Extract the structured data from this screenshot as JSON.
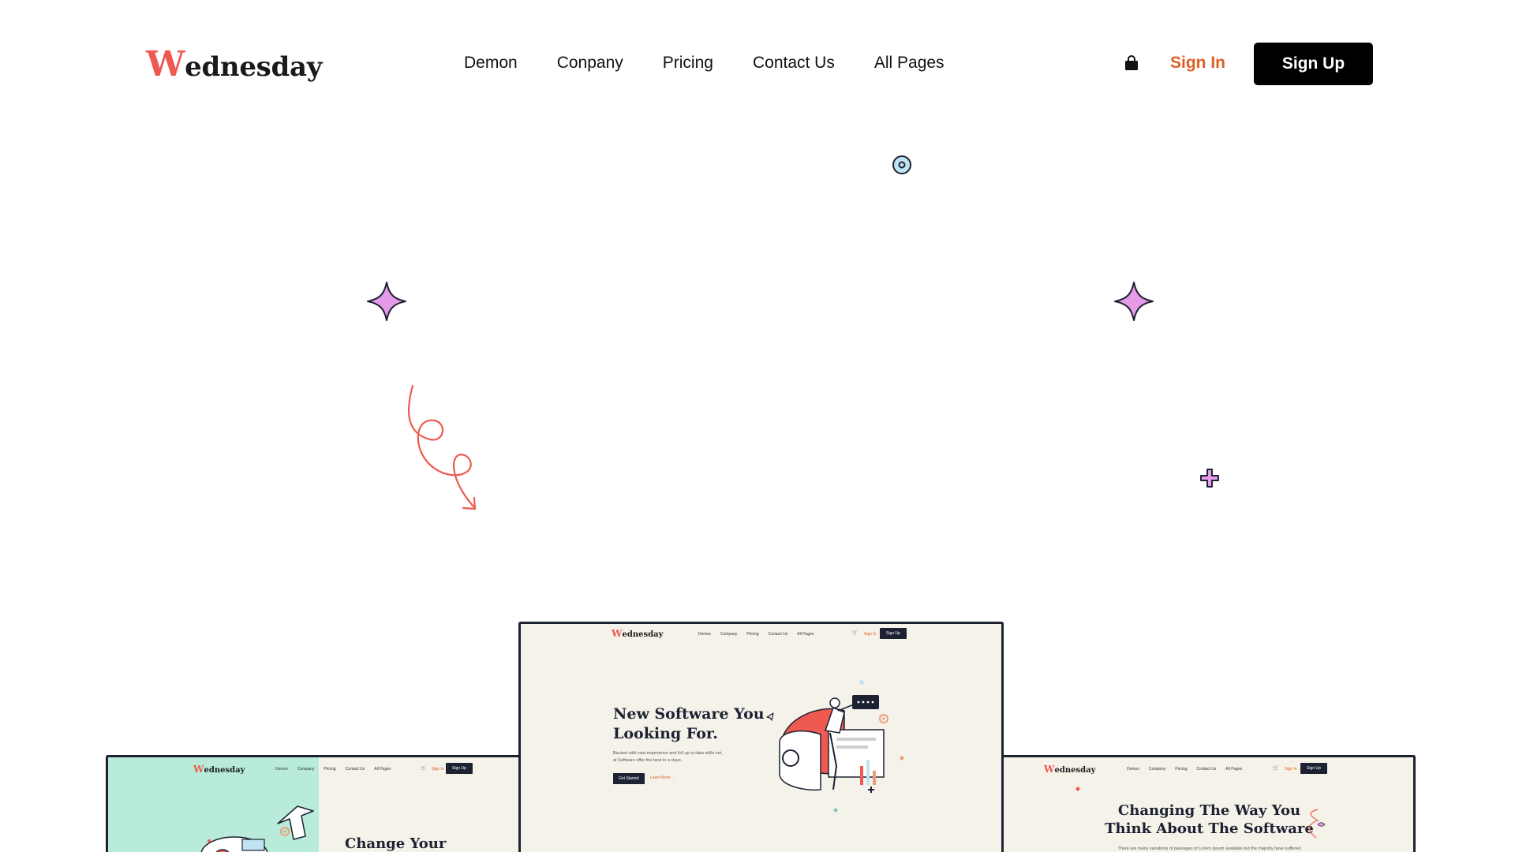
{
  "header": {
    "logo_initial": "W",
    "logo_rest": "ednesday",
    "nav": [
      "Demon",
      "Conpany",
      "Pricing",
      "Contact Us",
      "All Pages"
    ],
    "cart_icon": "shopping-bag-icon",
    "signin_label": "Sign In",
    "signup_label": "Sign Up"
  },
  "colors": {
    "accent": "#ee5a52",
    "signin": "#e25d22",
    "sparkle": "#e59be8",
    "dark": "#1d2233",
    "card_bg": "#f5f2ea",
    "mint": "#b8ebd9"
  },
  "decorations": [
    "target-icon",
    "sparkle-icon",
    "sparkle-icon",
    "curly-arrow-icon",
    "plus-icon"
  ],
  "previews": {
    "center": {
      "logo_initial": "W",
      "logo_rest": "ednesday",
      "nav": [
        "Demos",
        "Company",
        "Pricing",
        "Contact Us",
        "All Pages"
      ],
      "signin": "Sign In",
      "signup": "Sign Up",
      "title_line1": "New Software You",
      "title_line2": "Looking For.",
      "subtitle_line1": "Backed with vast experience and full up to data skills set,",
      "subtitle_line2": "at Software offer the best in a class.",
      "button": "Get Started",
      "link": "Learn More →"
    },
    "left": {
      "logo_initial": "W",
      "logo_rest": "ednesday",
      "nav": [
        "Demos",
        "Company",
        "Pricing",
        "Contact Us",
        "All Pages"
      ],
      "signin": "Sign In",
      "signup": "Sign Up",
      "title": "Change Your"
    },
    "right": {
      "logo_initial": "W",
      "logo_rest": "ednesday",
      "nav": [
        "Demos",
        "Company",
        "Pricing",
        "Contact Us",
        "All Pages"
      ],
      "signin": "Sign In",
      "signup": "Sign Up",
      "title_line1": "Changing The Way You",
      "title_line2": "Think About The Software",
      "subtitle": "There are many variations of passages of Lorem Ipsum available but the majority have suffered"
    }
  }
}
